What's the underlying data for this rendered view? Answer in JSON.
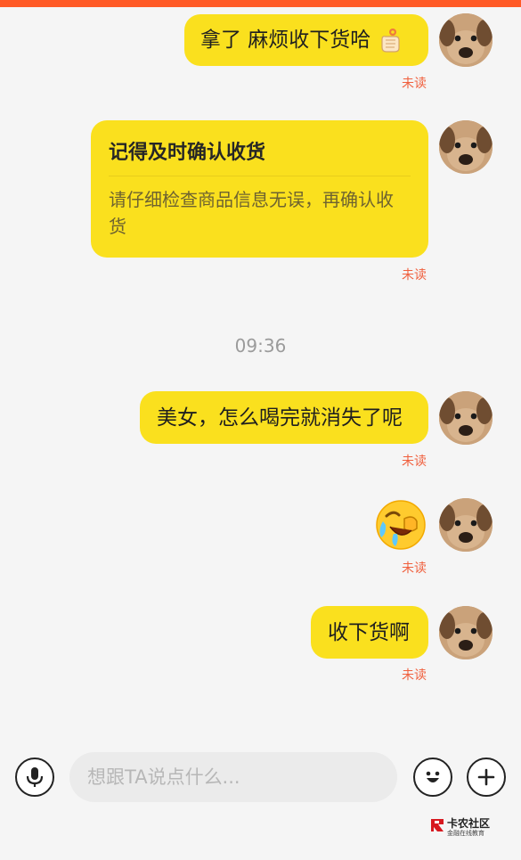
{
  "messages": [
    {
      "text": "拿了 麻烦收下货哈",
      "status": "未读"
    },
    {
      "card_title": "记得及时确认收货",
      "card_body": "请仔细检查商品信息无误，再确认收货",
      "status": "未读"
    },
    {
      "text": "美女，怎么喝完就消失了呢",
      "status": "未读"
    },
    {
      "emoji": "crying-laughing-facepalm",
      "status": "未读"
    },
    {
      "text": "收下货啊",
      "status": "未读"
    }
  ],
  "timestamp": "09:36",
  "input": {
    "placeholder": "想跟TA说点什么..."
  },
  "icons": [
    "microphone-icon",
    "emoji-icon",
    "plus-icon",
    "hand-gesture-icon"
  ],
  "watermark": {
    "title": "卡农社区",
    "subtitle": "金融在线教育"
  },
  "colors": {
    "bubble": "#fae01e",
    "unread": "#f0603e",
    "top_bar": "#ff5a26"
  }
}
